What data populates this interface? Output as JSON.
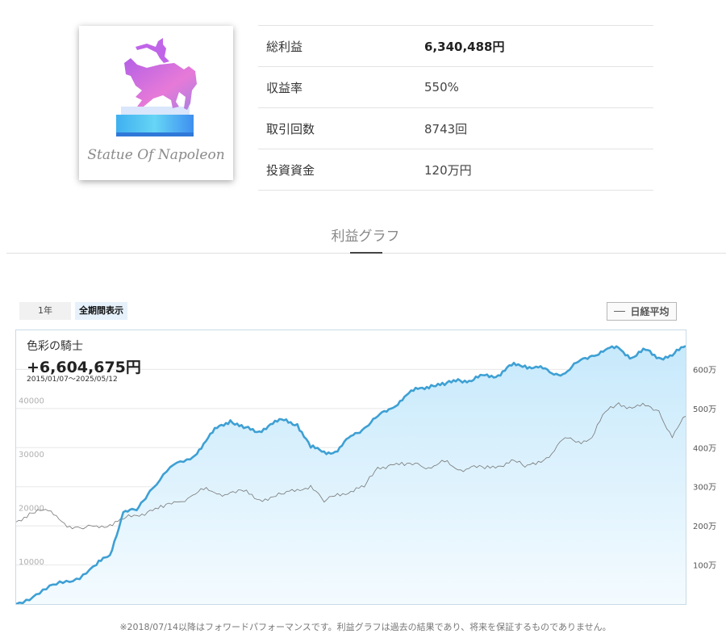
{
  "logo": {
    "text": "Statue Of Napoleon",
    "icon": "horse-rider-statue-icon"
  },
  "stats": [
    {
      "label": "総利益",
      "value": "6,340,488円",
      "bold": true
    },
    {
      "label": "収益率",
      "value": "550%",
      "bold": false
    },
    {
      "label": "取引回数",
      "value": "8743回",
      "bold": false
    },
    {
      "label": "投資資金",
      "value": "120万円",
      "bold": false
    }
  ],
  "section": {
    "title": "利益グラフ"
  },
  "range_buttons": {
    "one_year": "1年",
    "all": "全期間表示"
  },
  "legend": {
    "label": "日経平均"
  },
  "chart_header": {
    "name": "色彩の騎士",
    "total": "+6,604,675円",
    "period": "2015/01/07〜2025/05/12"
  },
  "footnote": "※2018/07/14以降はフォワードパフォーマンスです。利益グラフは過去の結果であり、将来を保証するものでありません。",
  "colors": {
    "profit_line": "#3ea0d4",
    "profit_fill_top": "#c7e9fb",
    "profit_fill_bottom": "#f4fbff",
    "nikkei_line": "#777777",
    "grid": "#e8e8e8",
    "plot_border": "#c9dbe6"
  },
  "chart_data": {
    "type": "area",
    "x_range": [
      "2015/01/07",
      "2025/05/12"
    ],
    "y_left_ticks": [
      {
        "label": "10000",
        "value": 10000
      },
      {
        "label": "20000",
        "value": 20000
      },
      {
        "label": "30000",
        "value": 30000
      },
      {
        "label": "40000",
        "value": 40000
      }
    ],
    "y_right_ticks": [
      {
        "label": "100万",
        "value": 1000000
      },
      {
        "label": "200万",
        "value": 2000000
      },
      {
        "label": "300万",
        "value": 3000000
      },
      {
        "label": "400万",
        "value": 4000000
      },
      {
        "label": "500万",
        "value": 5000000
      },
      {
        "label": "600万",
        "value": 6000000
      }
    ],
    "y_left_range": [
      2000,
      53000
    ],
    "y_right_range": [
      0,
      7000000
    ],
    "grid": true,
    "series": [
      {
        "name": "",
        "axis": "right",
        "x": [
          0,
          0.03,
          0.06,
          0.09,
          0.12,
          0.14,
          0.16,
          0.18,
          0.2,
          0.23,
          0.26,
          0.28,
          0.3,
          0.32,
          0.34,
          0.36,
          0.38,
          0.4,
          0.42,
          0.44,
          0.46,
          0.48,
          0.5,
          0.52,
          0.54,
          0.56,
          0.58,
          0.6,
          0.62,
          0.64,
          0.66,
          0.68,
          0.7,
          0.72,
          0.74,
          0.76,
          0.78,
          0.8,
          0.82,
          0.84,
          0.86,
          0.88,
          0.9,
          0.92,
          0.94,
          0.96,
          0.98,
          1.0
        ],
        "values": [
          0,
          250000,
          500000,
          650000,
          1000000,
          1250000,
          2350000,
          2400000,
          2900000,
          3500000,
          3700000,
          4100000,
          4500000,
          4700000,
          4500000,
          4400000,
          4600000,
          4700000,
          4600000,
          4000000,
          3900000,
          3900000,
          4300000,
          4500000,
          4800000,
          5000000,
          5300000,
          5500000,
          5600000,
          5600000,
          5750000,
          5700000,
          5850000,
          5850000,
          6100000,
          6100000,
          6050000,
          5900000,
          5900000,
          6200000,
          6350000,
          6500000,
          6550000,
          6300000,
          6500000,
          6300000,
          6350000,
          6600000
        ]
      },
      {
        "name": "日経平均",
        "axis": "left",
        "x": [
          0,
          0.02,
          0.04,
          0.06,
          0.08,
          0.1,
          0.12,
          0.14,
          0.16,
          0.18,
          0.2,
          0.22,
          0.24,
          0.26,
          0.28,
          0.3,
          0.32,
          0.34,
          0.36,
          0.38,
          0.4,
          0.42,
          0.44,
          0.46,
          0.48,
          0.5,
          0.52,
          0.54,
          0.56,
          0.58,
          0.6,
          0.62,
          0.64,
          0.66,
          0.68,
          0.7,
          0.72,
          0.74,
          0.76,
          0.78,
          0.8,
          0.82,
          0.84,
          0.86,
          0.88,
          0.9,
          0.92,
          0.94,
          0.96,
          0.98,
          1.0
        ],
        "values": [
          17300,
          19000,
          19500,
          18500,
          16500,
          16000,
          16600,
          16800,
          17800,
          18500,
          19500,
          20000,
          21000,
          22000,
          23300,
          22500,
          22800,
          23000,
          21500,
          21900,
          22500,
          23400,
          24100,
          21000,
          22600,
          23000,
          23800,
          27500,
          28000,
          27800,
          28200,
          27300,
          28500,
          27000,
          27600,
          27200,
          27700,
          28900,
          27500,
          28600,
          30000,
          33000,
          32300,
          33000,
          37800,
          39500,
          38500,
          38900,
          38000,
          33000,
          37000
        ]
      }
    ]
  }
}
